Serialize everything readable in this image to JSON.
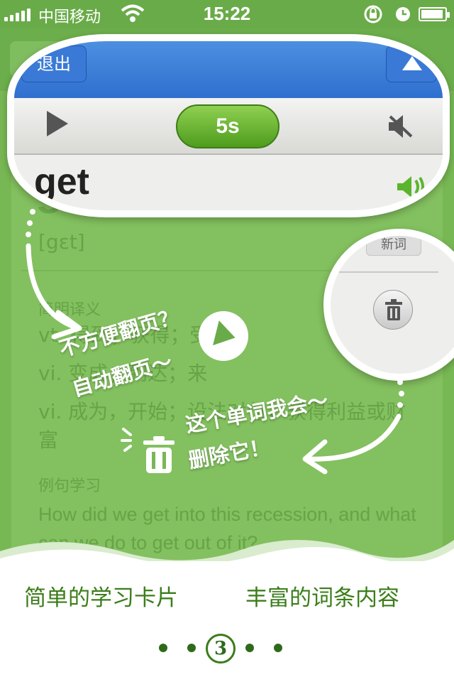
{
  "status_bar": {
    "carrier": "中国移动",
    "time": "15:22",
    "battery_level": 0.95
  },
  "background_card": {
    "word": "get",
    "phonetic": "[gɛt]",
    "definitions_label": "简明译义",
    "definitions": [
      "vt. 得到；获得；受到",
      "vi. 变成；到达；来",
      "vi. 成为，开始；设法对付，获得利益或财富"
    ],
    "example_label": "例句学习",
    "example_sentence": "How did we get into this recession, and what can we do to get out of it?"
  },
  "zoom_card": {
    "exit_label": "退出",
    "timer": "5s",
    "word": "get",
    "new_word_tag": "新词"
  },
  "callouts": {
    "auto_page": [
      "不方便翻页？",
      "自动翻页～"
    ],
    "delete_word": [
      "这个单词我会～",
      "删除它！"
    ]
  },
  "footer": {
    "features": [
      "简单的学习卡片",
      "丰富的词条内容"
    ],
    "current_page": "3",
    "page_count": 5
  },
  "colors": {
    "brand_green": "#6aab49",
    "footer_text": "#3b7d1a",
    "nav_blue": "#2f6fcf"
  }
}
